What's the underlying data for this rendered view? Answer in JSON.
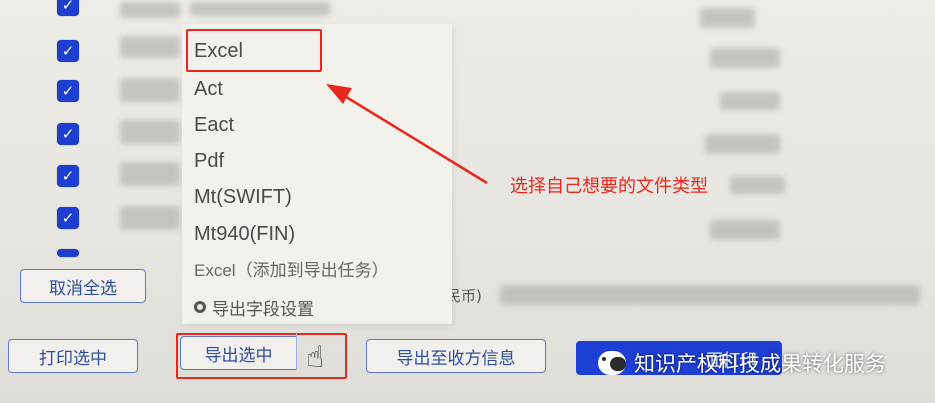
{
  "dropdown": {
    "items": [
      {
        "label": "Excel"
      },
      {
        "label": "Act"
      },
      {
        "label": "Eact"
      },
      {
        "label": "Pdf"
      },
      {
        "label": "Mt(SWIFT)"
      },
      {
        "label": "Mt940(FIN)"
      },
      {
        "label": "Excel（添加到导出任务）"
      }
    ],
    "field_setting_label": "导出字段设置"
  },
  "annotation": {
    "text": "选择自己想要的文件类型",
    "color": "#e8281e"
  },
  "buttons": {
    "deselect_all": "取消全选",
    "print_selected": "打印选中",
    "export_selected": "导出选中",
    "export_to_payee": "导出至收方信息",
    "primary_partial": "面打印"
  },
  "footer": {
    "currency_fragment": "民币)"
  },
  "watermark": {
    "text": "知识产权科技成果转化服务"
  },
  "colors": {
    "checkbox": "#1c3fd2",
    "accent": "#1e3fd4",
    "highlight": "#e8281e"
  },
  "checkbox_count": 7
}
